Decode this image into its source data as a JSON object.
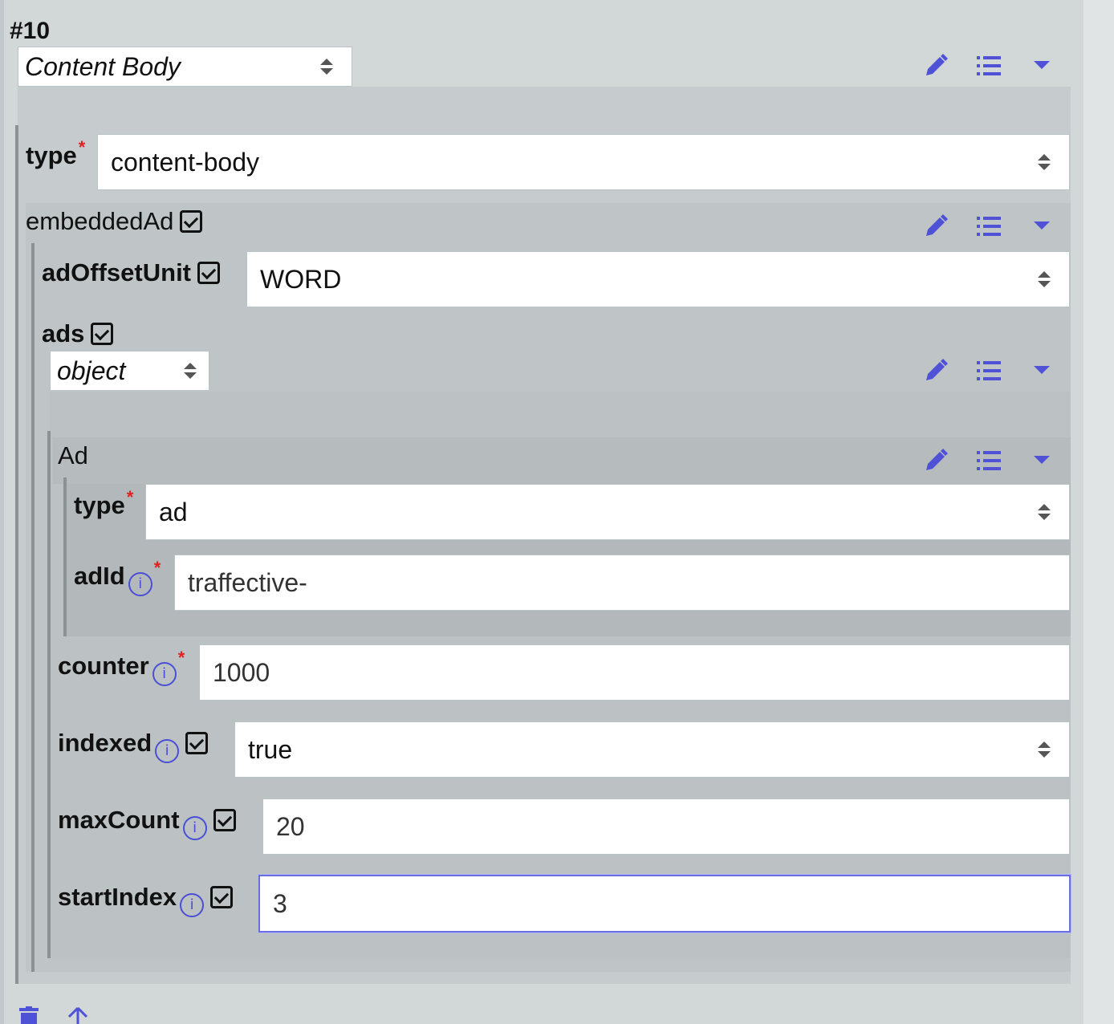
{
  "item": {
    "number": "#10",
    "schema_select": "Content Body"
  },
  "fields": {
    "type": {
      "label": "type",
      "required": "*",
      "value": "content-body"
    },
    "embeddedAd": {
      "label": "embeddedAd",
      "adOffsetUnit": {
        "label": "adOffsetUnit",
        "value": "WORD"
      },
      "ads": {
        "label": "ads",
        "item_select": "object",
        "ad": {
          "title": "Ad",
          "type": {
            "label": "type",
            "required": "*",
            "value": "ad"
          },
          "adId": {
            "label": "adId",
            "info": "i",
            "required": "*",
            "value": "traffective-"
          }
        },
        "counter": {
          "label": "counter",
          "info": "i",
          "required": "*",
          "value": "1000"
        },
        "indexed": {
          "label": "indexed",
          "info": "i",
          "value": "true"
        },
        "maxCount": {
          "label": "maxCount",
          "info": "i",
          "value": "20"
        },
        "startIndex": {
          "label": "startIndex",
          "info": "i",
          "value": "3"
        }
      }
    }
  },
  "icons": {
    "edit": "pencil-icon",
    "properties": "list-icon",
    "collapse": "caret-down-icon",
    "delete": "trash-icon",
    "move_up": "arrow-up-icon"
  },
  "colors": {
    "accent": "#4f52d6",
    "required": "#e02020",
    "background": "#d2d7d8",
    "panel": "#c6cccd"
  }
}
